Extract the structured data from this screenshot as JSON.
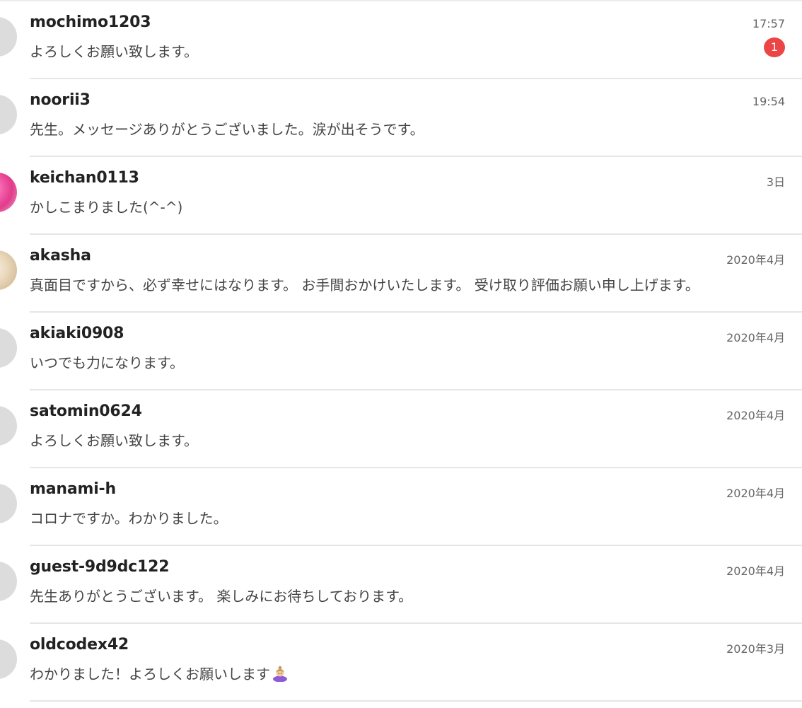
{
  "conversations": [
    {
      "username": "mochimo1203",
      "message": "よろしくお願い致します。",
      "time": "17:57",
      "unread": "1",
      "avatar": "gray"
    },
    {
      "username": "noorii3",
      "message": "先生。メッセージありがとうございました。涙が出そうです。",
      "time": "19:54",
      "avatar": "gray"
    },
    {
      "username": "keichan0113",
      "message": "かしこまりました(^-^)",
      "time": "3日",
      "avatar": "pink"
    },
    {
      "username": "akasha",
      "message": "真面目ですから、必ず幸せにはなります。 お手間おかけいたします。 受け取り評価お願い申し上げます。",
      "time": "2020年4月",
      "avatar": "beige"
    },
    {
      "username": "akiaki0908",
      "message": "いつでも力になります。",
      "time": "2020年4月",
      "avatar": "gray"
    },
    {
      "username": "satomin0624",
      "message": "よろしくお願い致します。",
      "time": "2020年4月",
      "avatar": "gray"
    },
    {
      "username": "manami-h",
      "message": "コロナですか。わかりました。",
      "time": "2020年4月",
      "avatar": "gray"
    },
    {
      "username": "guest-9d9dc122",
      "message": "先生ありがとうございます。 楽しみにお待ちしております。",
      "time": "2020年4月",
      "avatar": "gray"
    },
    {
      "username": "oldcodex42",
      "message": "わかりました！よろしくお願いします",
      "message_emoji": "person-bowing-emoji",
      "time": "2020年3月",
      "avatar": "gray"
    }
  ],
  "colors": {
    "badge": "#ec4545",
    "divider": "#e6e6e6",
    "username": "#222222",
    "message": "#444444",
    "time": "#666666"
  }
}
